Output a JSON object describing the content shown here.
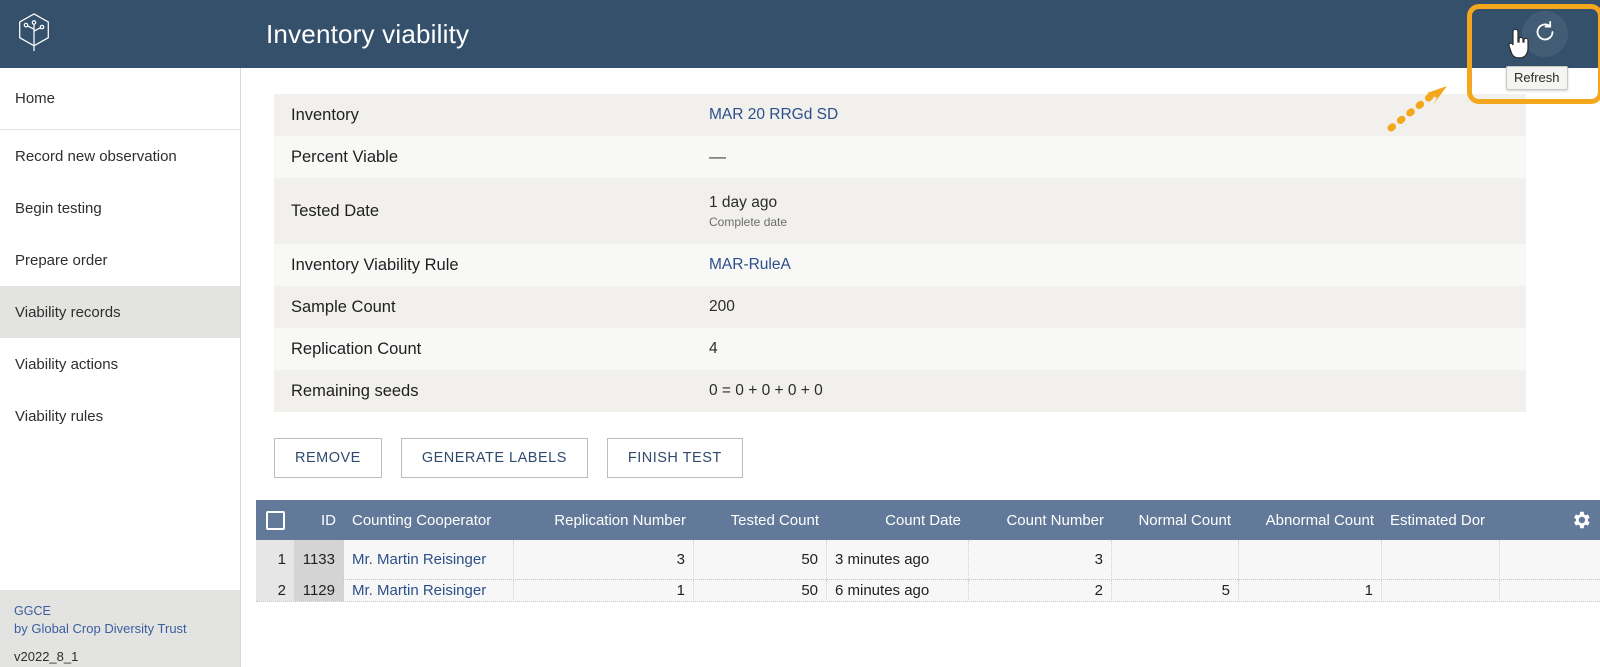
{
  "app": {
    "title": "Inventory viability",
    "logo_icon": "hexagon-plant-logo-icon"
  },
  "header": {
    "refresh_icon": "refresh-icon",
    "refresh_tooltip": "Refresh",
    "cursor_icon": "pointing-hand-cursor-icon",
    "highlight_color": "#f4a71d"
  },
  "sidebar": {
    "items": [
      {
        "label": "Home",
        "active": false
      },
      {
        "label": "Record new observation",
        "active": false
      },
      {
        "label": "Begin testing",
        "active": false
      },
      {
        "label": "Prepare order",
        "active": false
      },
      {
        "label": "Viability records",
        "active": true
      },
      {
        "label": "Viability actions",
        "active": false
      },
      {
        "label": "Viability rules",
        "active": false
      }
    ],
    "footer": {
      "brand": "GGCE",
      "by": "by Global Crop Diversity Trust",
      "version": "v2022_8_1"
    }
  },
  "details": {
    "rows": [
      {
        "label": "Inventory",
        "value": "MAR 20 RRGd SD",
        "link": true
      },
      {
        "label": "Percent Viable",
        "value": "—",
        "link": false
      },
      {
        "label": "Tested Date",
        "value": "1 day ago",
        "link": false,
        "sub": "Complete date"
      },
      {
        "label": "Inventory Viability Rule",
        "value": "MAR-RuleA",
        "link": true
      },
      {
        "label": "Sample Count",
        "value": "200",
        "link": false
      },
      {
        "label": "Replication Count",
        "value": "4",
        "link": false
      },
      {
        "label": "Remaining seeds",
        "value": "0 = 0 + 0 + 0 + 0",
        "link": false
      }
    ]
  },
  "actions": {
    "remove": "REMOVE",
    "generate_labels": "GENERATE LABELS",
    "finish_test": "FINISH TEST"
  },
  "grid": {
    "select_all_icon": "checkbox-unchecked-icon",
    "settings_icon": "gear-icon",
    "columns": [
      "ID",
      "Counting Cooperator",
      "Replication Number",
      "Tested Count",
      "Count Date",
      "Count Number",
      "Normal Count",
      "Abnormal Count",
      "Estimated Dor"
    ],
    "rows": [
      {
        "index": "1",
        "id": "1133",
        "cooperator": "Mr. Martin Reisinger",
        "replication_number": "3",
        "tested_count": "50",
        "count_date": "3 minutes ago",
        "count_number": "3",
        "normal_count": "",
        "abnormal_count": "",
        "estimated_dormant": ""
      },
      {
        "index": "2",
        "id": "1129",
        "cooperator": "Mr. Martin Reisinger",
        "replication_number": "1",
        "tested_count": "50",
        "count_date": "6 minutes ago",
        "count_number": "2",
        "normal_count": "5",
        "abnormal_count": "1",
        "estimated_dormant": ""
      }
    ]
  }
}
